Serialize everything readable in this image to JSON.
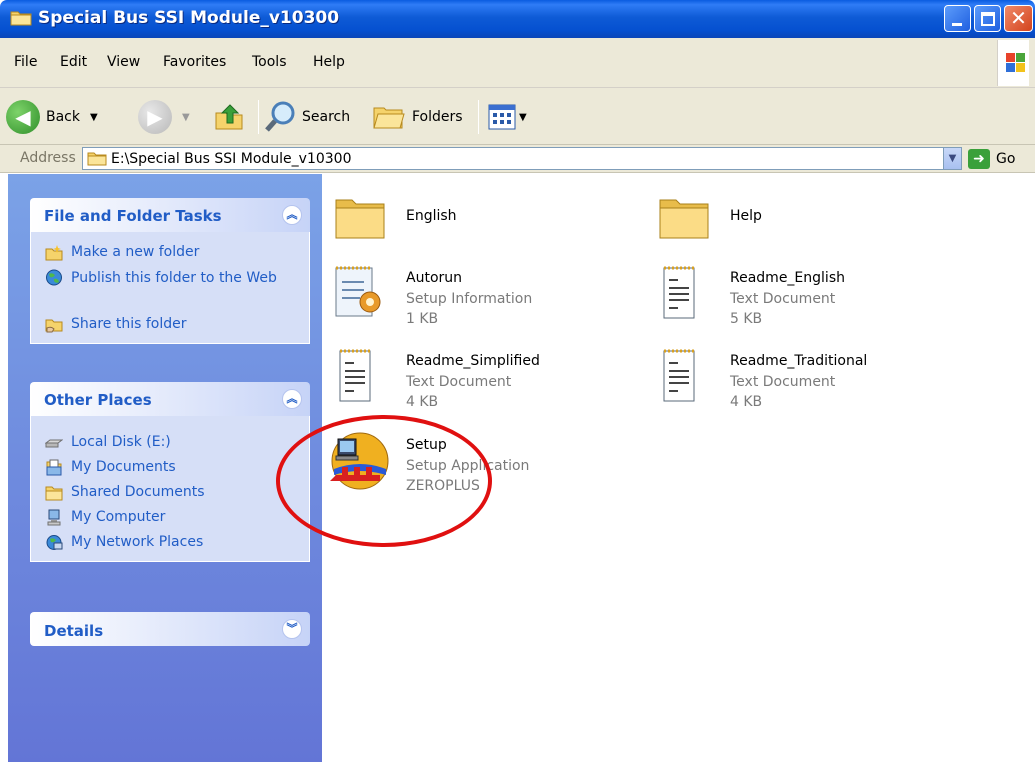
{
  "window": {
    "title": "Special Bus SSI Module_v10300"
  },
  "menu": [
    "File",
    "Edit",
    "View",
    "Favorites",
    "Tools",
    "Help"
  ],
  "toolbar": {
    "back": "Back",
    "search": "Search",
    "folders": "Folders"
  },
  "address": {
    "label": "Address",
    "value": "E:\\Special Bus SSI Module_v10300",
    "go": "Go"
  },
  "tasks": {
    "title": "File and Folder Tasks",
    "items": [
      "Make a new folder",
      "Publish this folder to the Web",
      "Share this folder"
    ]
  },
  "places": {
    "title": "Other Places",
    "items": [
      "Local Disk (E:)",
      "My Documents",
      "Shared Documents",
      "My Computer",
      "My Network Places"
    ]
  },
  "details": {
    "title": "Details"
  },
  "files": [
    {
      "name": "English"
    },
    {
      "name": "Help"
    },
    {
      "name": "Autorun",
      "type": "Setup Information",
      "size": "1 KB"
    },
    {
      "name": "Readme_English",
      "type": "Text Document",
      "size": "5 KB"
    },
    {
      "name": "Readme_Simplified",
      "type": "Text Document",
      "size": "4 KB"
    },
    {
      "name": "Readme_Traditional",
      "type": "Text Document",
      "size": "4 KB"
    },
    {
      "name": "Setup",
      "type": "Setup Application",
      "size": "ZEROPLUS"
    }
  ],
  "colors": {
    "titlebar": "#0550d0",
    "task_link": "#215dc6",
    "highlight": "#e01010"
  }
}
